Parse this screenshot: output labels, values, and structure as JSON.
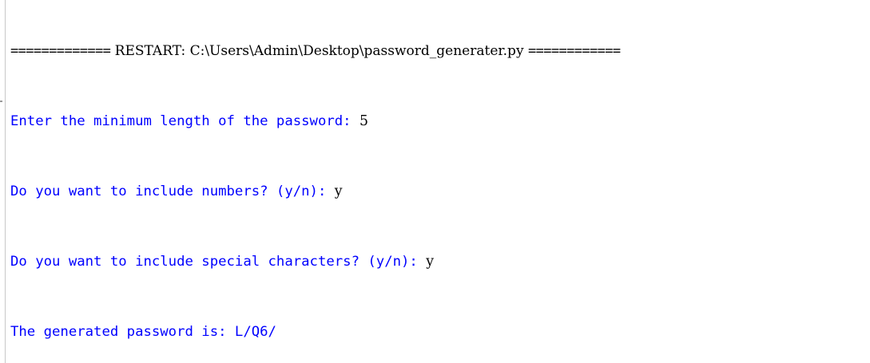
{
  "shell": {
    "restart": {
      "left_rule": "=============",
      "label": "RESTART:",
      "path": "C:\\Users\\Admin\\Desktop\\password_generater.py",
      "right_rule": "============"
    },
    "lines": [
      {
        "prompt": "Enter the minimum length of the password: ",
        "input": "5"
      },
      {
        "prompt": "Do you want to include numbers? (y/n): ",
        "input": "y"
      },
      {
        "prompt": "Do you want to include special characters? (y/n): ",
        "input": "y"
      },
      {
        "prompt": "The generated password is: L/Q6/",
        "input": ""
      }
    ]
  },
  "colors": {
    "prompt": "#0000ff",
    "input": "#000000",
    "restart": "#000000"
  }
}
